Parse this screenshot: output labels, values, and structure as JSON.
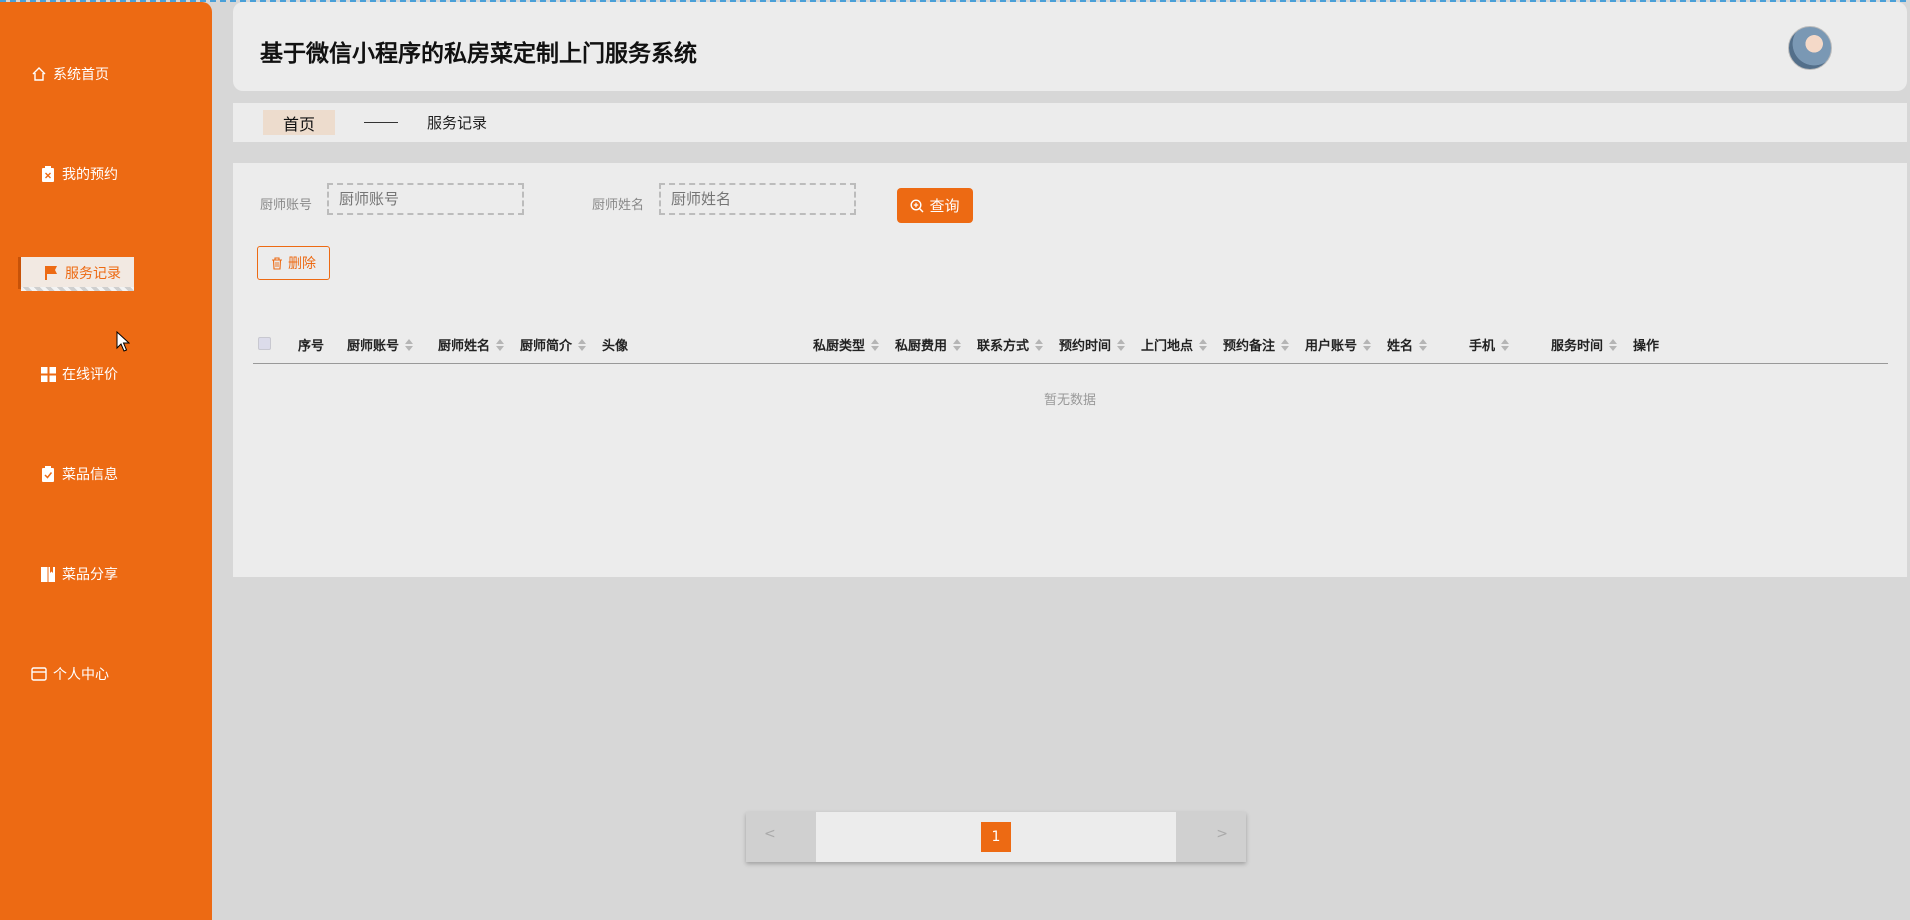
{
  "app": {
    "title": "基于微信小程序的私房菜定制上门服务系统"
  },
  "sidebar": {
    "items": [
      {
        "label": "系统首页",
        "icon": "home-icon"
      },
      {
        "label": "我的预约",
        "icon": "clipboard-x-icon"
      },
      {
        "label": "服务记录",
        "icon": "flag-icon",
        "active": true
      },
      {
        "label": "在线评价",
        "icon": "grid-icon"
      },
      {
        "label": "菜品信息",
        "icon": "clipboard-check-icon"
      },
      {
        "label": "菜品分享",
        "icon": "book-icon"
      },
      {
        "label": "个人中心",
        "icon": "card-icon"
      }
    ]
  },
  "breadcrumb": {
    "home": "首页",
    "current": "服务记录"
  },
  "search": {
    "chef_account_label": "厨师账号",
    "chef_account_placeholder": "厨师账号",
    "chef_name_label": "厨师姓名",
    "chef_name_placeholder": "厨师姓名",
    "query_label": "查询"
  },
  "actions": {
    "delete_label": "删除"
  },
  "table": {
    "columns": [
      "序号",
      "厨师账号",
      "厨师姓名",
      "厨师简介",
      "头像",
      "私厨类型",
      "私厨费用",
      "联系方式",
      "预约时间",
      "上门地点",
      "预约备注",
      "用户账号",
      "姓名",
      "手机",
      "服务时间",
      "操作"
    ],
    "empty_text": "暂无数据"
  },
  "pagination": {
    "prev": "<",
    "next": ">",
    "current_page": "1"
  },
  "colors": {
    "accent": "#ed6a13",
    "sidebar_bg": "#ed6a13",
    "page_bg": "#d7d7d7",
    "panel_bg": "#ececec"
  }
}
